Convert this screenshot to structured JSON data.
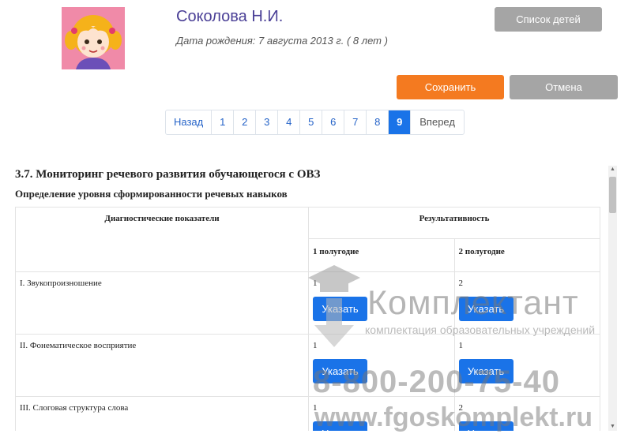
{
  "child": {
    "name": "Соколова Н.И.",
    "birth": "Дата рождения: 7 августа 2013 г. ( 8 лет )"
  },
  "buttons": {
    "children_list": "Список детей",
    "save": "Сохранить",
    "cancel": "Отмена"
  },
  "pagination": {
    "prev": "Назад",
    "pages": [
      "1",
      "2",
      "3",
      "4",
      "5",
      "6",
      "7",
      "8",
      "9"
    ],
    "current": "9",
    "next": "Вперед"
  },
  "section": {
    "title": "3.7. Мониторинг речевого развития обучающегося с ОВЗ",
    "subtitle": "Определение уровня сформированности речевых навыков"
  },
  "table": {
    "col_indicators": "Диагностические показатели",
    "col_results": "Результативность",
    "col_half1": "1 полугодие",
    "col_half2": "2 полугодие",
    "set_label": "Указать",
    "rows": [
      {
        "indicator": "I. Звукопроизношение",
        "h1": "1",
        "h2": "2"
      },
      {
        "indicator": "II. Фонематическое восприятие",
        "h1": "1",
        "h2": "1"
      },
      {
        "indicator": "III. Слоговая структура слова",
        "h1": "1",
        "h2": "2"
      }
    ]
  },
  "watermark": {
    "brand": "Комплектант",
    "tagline": "комплектация образовательных учреждений",
    "phone": "8-800-200-75-40",
    "site": "www.fgoskomplekt.ru"
  },
  "colors": {
    "accent_orange": "#f47a20",
    "primary_blue": "#1a73e8",
    "name_purple": "#4a3f96",
    "gray_button": "#a5a5a5",
    "avatar_bg": "#f08aa8"
  },
  "icons": {
    "avatar": "girl-cartoon-avatar",
    "watermark_logo": "graduation-cap-arrow-icon",
    "scroll_up": "triangle-up-icon",
    "scroll_down": "triangle-down-icon"
  }
}
